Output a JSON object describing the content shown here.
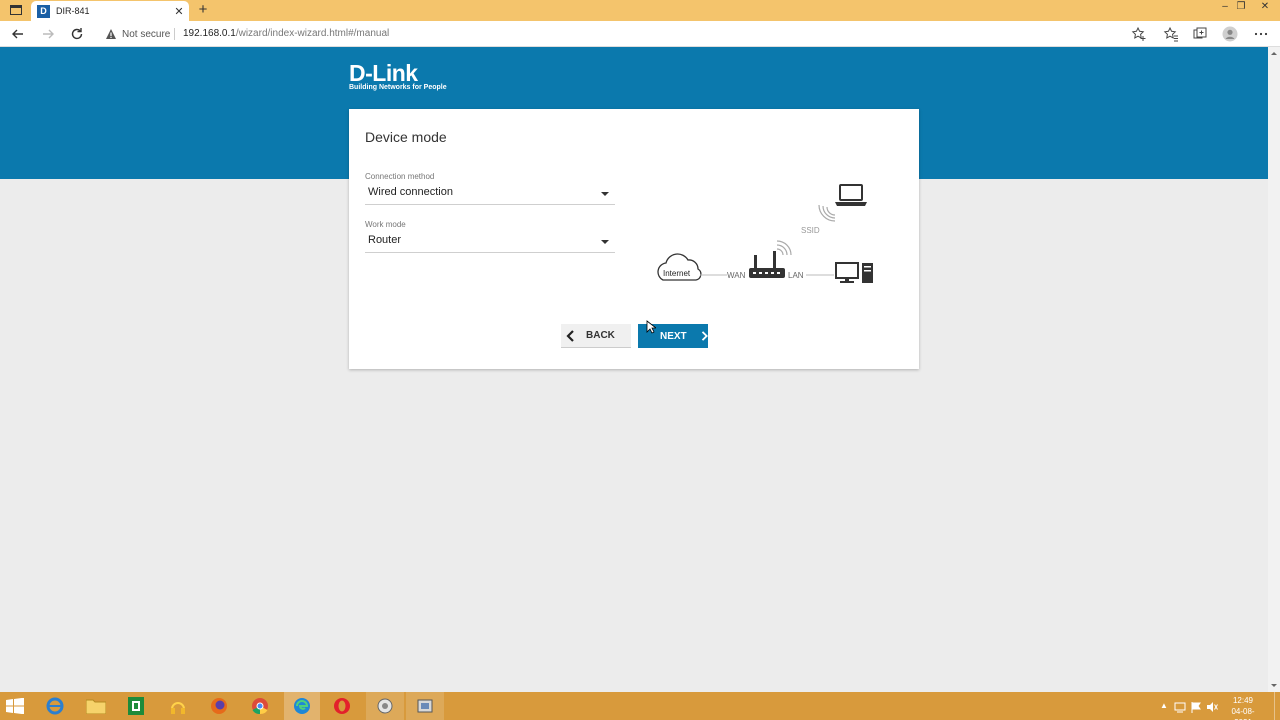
{
  "browser": {
    "tab_title": "DIR-841",
    "tab_favicon": "D",
    "security_label": "Not secure",
    "url_host": "192.168.0.1",
    "url_path": "/wizard/index-wizard.html#/manual"
  },
  "brand": {
    "logo": "D-Link",
    "tagline": "Building Networks for People",
    "accent_color": "#0b79ad"
  },
  "wizard": {
    "title": "Device mode",
    "connection_method_label": "Connection method",
    "connection_method_value": "Wired connection",
    "work_mode_label": "Work mode",
    "work_mode_value": "Router",
    "back_label": "BACK",
    "next_label": "NEXT"
  },
  "diagram": {
    "internet": "Internet",
    "wan": "WAN",
    "lan": "LAN",
    "ssid": "SSID"
  },
  "taskbar": {
    "time": "12:49",
    "date": "04-08-2021"
  }
}
